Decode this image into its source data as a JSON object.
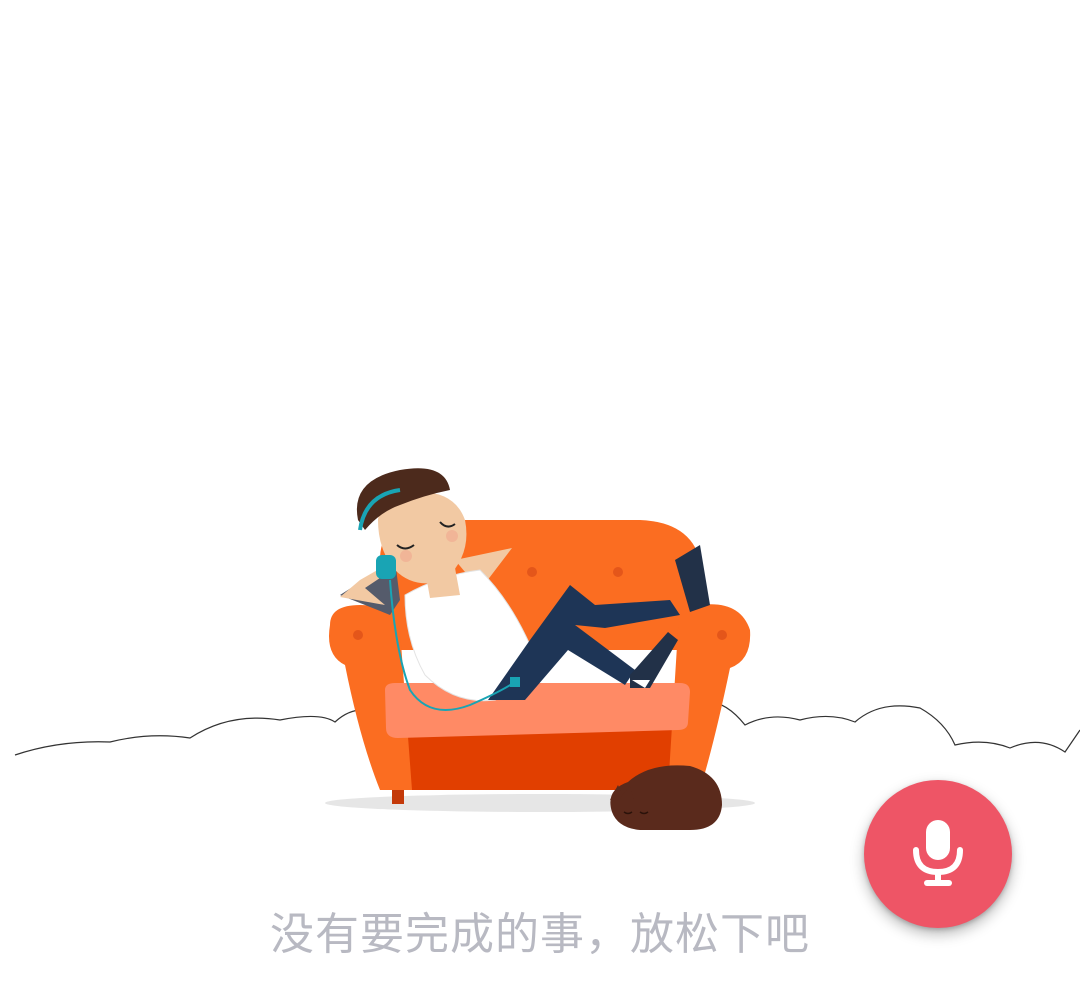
{
  "empty_state": {
    "message": "没有要完成的事，放松下吧",
    "illustration": "relaxing-person-on-sofa-with-cat"
  },
  "voice_fab": {
    "icon": "microphone-icon",
    "color": "#ee5566"
  },
  "colors": {
    "message_text": "#b8b9c2",
    "sofa": "#fb6d21",
    "cat": "#5a2a1c"
  }
}
